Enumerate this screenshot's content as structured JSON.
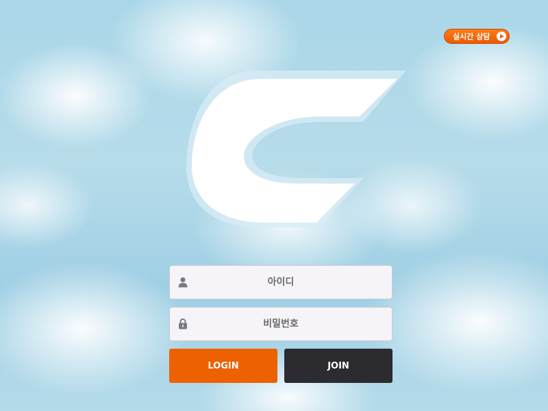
{
  "header": {
    "chat_button_label": "실시간 상담",
    "chat_button_icon": "play-icon"
  },
  "brand": {
    "logo_icon": "c-logo-icon",
    "logo_color": "#ffffff"
  },
  "form": {
    "id_field": {
      "placeholder": "아이디",
      "value": "",
      "icon": "user-icon"
    },
    "password_field": {
      "placeholder": "비밀번호",
      "value": "",
      "icon": "lock-icon"
    },
    "login_label": "LOGIN",
    "join_label": "JOIN"
  },
  "colors": {
    "accent": "#ee6100",
    "join_button": "#2b2b30",
    "field_background": "#f6f4f8",
    "sky": "#a9d6e8"
  }
}
